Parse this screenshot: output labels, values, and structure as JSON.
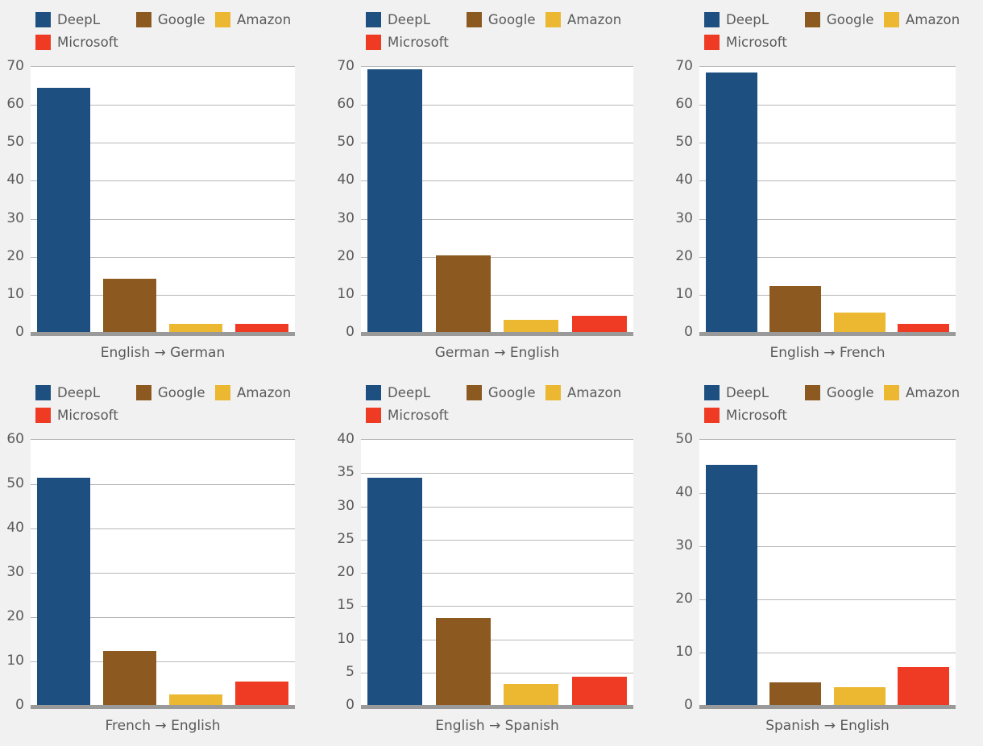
{
  "legend": {
    "series": [
      {
        "name": "DeepL",
        "color": "#1d5080"
      },
      {
        "name": "Google",
        "color": "#8c5a20"
      },
      {
        "name": "Amazon",
        "color": "#ecb731"
      },
      {
        "name": "Microsoft",
        "color": "#ef3b23"
      }
    ]
  },
  "theme": {
    "background": "#f1f1f1",
    "plot_background": "#ffffff",
    "gridline": "#b8b8b8",
    "baseline": "#9a9a9a",
    "text": "#5a5a5a"
  },
  "chart_data": [
    {
      "type": "bar",
      "title": "",
      "xlabel": "English → German",
      "ylabel": "",
      "categories": [
        "DeepL",
        "Google",
        "Amazon",
        "Microsoft"
      ],
      "values": [
        64.2,
        14.0,
        2.1,
        2.1
      ],
      "colors": [
        "#1d5080",
        "#8c5a20",
        "#ecb731",
        "#ef3b23"
      ],
      "ylim": [
        0,
        70
      ],
      "yticks": [
        0,
        10,
        20,
        30,
        40,
        50,
        60,
        70
      ],
      "grid": true,
      "legend": [
        "DeepL",
        "Google",
        "Amazon",
        "Microsoft"
      ],
      "legend_position": "top-left"
    },
    {
      "type": "bar",
      "title": "",
      "xlabel": "German → English",
      "ylabel": "",
      "categories": [
        "DeepL",
        "Google",
        "Amazon",
        "Microsoft"
      ],
      "values": [
        69.2,
        20.1,
        3.2,
        4.2
      ],
      "colors": [
        "#1d5080",
        "#8c5a20",
        "#ecb731",
        "#ef3b23"
      ],
      "ylim": [
        0,
        70
      ],
      "yticks": [
        0,
        10,
        20,
        30,
        40,
        50,
        60,
        70
      ],
      "grid": true,
      "legend": [
        "DeepL",
        "Google",
        "Amazon",
        "Microsoft"
      ],
      "legend_position": "top-left"
    },
    {
      "type": "bar",
      "title": "",
      "xlabel": "English → French",
      "ylabel": "",
      "categories": [
        "DeepL",
        "Google",
        "Amazon",
        "Microsoft"
      ],
      "values": [
        68.3,
        12.0,
        5.2,
        2.2
      ],
      "colors": [
        "#1d5080",
        "#8c5a20",
        "#ecb731",
        "#ef3b23"
      ],
      "ylim": [
        0,
        70
      ],
      "yticks": [
        0,
        10,
        20,
        30,
        40,
        50,
        60,
        70
      ],
      "grid": true,
      "legend": [
        "DeepL",
        "Google",
        "Amazon",
        "Microsoft"
      ],
      "legend_position": "top-left"
    },
    {
      "type": "bar",
      "title": "",
      "xlabel": "French → English",
      "ylabel": "",
      "categories": [
        "DeepL",
        "Google",
        "Amazon",
        "Microsoft"
      ],
      "values": [
        51.2,
        12.1,
        2.3,
        5.3
      ],
      "colors": [
        "#1d5080",
        "#8c5a20",
        "#ecb731",
        "#ef3b23"
      ],
      "ylim": [
        0,
        60
      ],
      "yticks": [
        0,
        10,
        20,
        30,
        40,
        50,
        60
      ],
      "grid": true,
      "legend": [
        "DeepL",
        "Google",
        "Amazon",
        "Microsoft"
      ],
      "legend_position": "top-left"
    },
    {
      "type": "bar",
      "title": "",
      "xlabel": "English → Spanish",
      "ylabel": "",
      "categories": [
        "DeepL",
        "Google",
        "Amazon",
        "Microsoft"
      ],
      "values": [
        34.2,
        13.1,
        3.1,
        4.2
      ],
      "colors": [
        "#1d5080",
        "#8c5a20",
        "#ecb731",
        "#ef3b23"
      ],
      "ylim": [
        0,
        40
      ],
      "yticks": [
        0,
        5,
        10,
        15,
        20,
        25,
        30,
        35,
        40
      ],
      "grid": true,
      "legend": [
        "DeepL",
        "Google",
        "Amazon",
        "Microsoft"
      ],
      "legend_position": "top-left"
    },
    {
      "type": "bar",
      "title": "",
      "xlabel": "Spanish → English",
      "ylabel": "",
      "categories": [
        "DeepL",
        "Google",
        "Amazon",
        "Microsoft"
      ],
      "values": [
        45.1,
        4.3,
        3.4,
        7.1
      ],
      "colors": [
        "#1d5080",
        "#8c5a20",
        "#ecb731",
        "#ef3b23"
      ],
      "ylim": [
        0,
        50
      ],
      "yticks": [
        0,
        10,
        20,
        30,
        40,
        50
      ],
      "grid": true,
      "legend": [
        "DeepL",
        "Google",
        "Amazon",
        "Microsoft"
      ],
      "legend_position": "top-left"
    }
  ]
}
